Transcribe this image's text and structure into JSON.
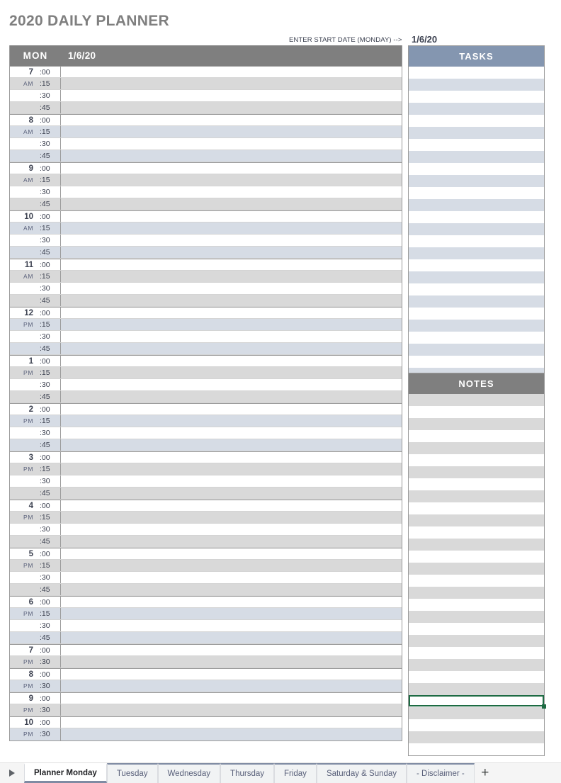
{
  "document": {
    "title": "2020 DAILY PLANNER"
  },
  "start_date": {
    "note": "ENTER START DATE (MONDAY) -->",
    "value": "1/6/20"
  },
  "schedule": {
    "day_of_week": "MON",
    "date": "1/6/20",
    "hours": [
      {
        "hour": "7",
        "ampm": "AM",
        "shade": "gray",
        "minutes": [
          ":00",
          ":15",
          ":30",
          ":45"
        ]
      },
      {
        "hour": "8",
        "ampm": "AM",
        "shade": "blue",
        "minutes": [
          ":00",
          ":15",
          ":30",
          ":45"
        ]
      },
      {
        "hour": "9",
        "ampm": "AM",
        "shade": "gray",
        "minutes": [
          ":00",
          ":15",
          ":30",
          ":45"
        ]
      },
      {
        "hour": "10",
        "ampm": "AM",
        "shade": "blue",
        "minutes": [
          ":00",
          ":15",
          ":30",
          ":45"
        ]
      },
      {
        "hour": "11",
        "ampm": "AM",
        "shade": "gray",
        "minutes": [
          ":00",
          ":15",
          ":30",
          ":45"
        ]
      },
      {
        "hour": "12",
        "ampm": "PM",
        "shade": "blue",
        "minutes": [
          ":00",
          ":15",
          ":30",
          ":45"
        ]
      },
      {
        "hour": "1",
        "ampm": "PM",
        "shade": "gray",
        "minutes": [
          ":00",
          ":15",
          ":30",
          ":45"
        ]
      },
      {
        "hour": "2",
        "ampm": "PM",
        "shade": "blue",
        "minutes": [
          ":00",
          ":15",
          ":30",
          ":45"
        ]
      },
      {
        "hour": "3",
        "ampm": "PM",
        "shade": "gray",
        "minutes": [
          ":00",
          ":15",
          ":30",
          ":45"
        ]
      },
      {
        "hour": "4",
        "ampm": "PM",
        "shade": "gray",
        "minutes": [
          ":00",
          ":15",
          ":30",
          ":45"
        ]
      },
      {
        "hour": "5",
        "ampm": "PM",
        "shade": "gray",
        "minutes": [
          ":00",
          ":15",
          ":30",
          ":45"
        ]
      },
      {
        "hour": "6",
        "ampm": "PM",
        "shade": "blue",
        "minutes": [
          ":00",
          ":15",
          ":30",
          ":45"
        ]
      },
      {
        "hour": "7",
        "ampm": "PM",
        "shade": "gray",
        "minutes": [
          ":00",
          ":30"
        ]
      },
      {
        "hour": "8",
        "ampm": "PM",
        "shade": "blue",
        "minutes": [
          ":00",
          ":30"
        ]
      },
      {
        "hour": "9",
        "ampm": "PM",
        "shade": "gray",
        "minutes": [
          ":00",
          ":30"
        ]
      },
      {
        "hour": "10",
        "ampm": "PM",
        "shade": "blue",
        "minutes": [
          ":00",
          ":30"
        ]
      }
    ],
    "entries": []
  },
  "tasks_panel": {
    "header": "TASKS",
    "row_count": 26,
    "first_row_shade": "white",
    "shade_color": "#d6dce5",
    "items": []
  },
  "notes_panel": {
    "header": "NOTES",
    "row_count": 30,
    "first_row_shade": "gray",
    "shade_color": "#d9d9d9",
    "items": [],
    "selected_row_index": 25
  },
  "selection": {
    "border_color": "#1d6b43",
    "has_fill_handle": true
  },
  "sheet_tabs": {
    "nav_icon": "play-triangle-icon",
    "add_icon": "+",
    "tabs": [
      {
        "label": "Planner Monday",
        "active": true
      },
      {
        "label": "Tuesday",
        "active": false
      },
      {
        "label": "Wednesday",
        "active": false
      },
      {
        "label": "Thursday",
        "active": false
      },
      {
        "label": "Friday",
        "active": false
      },
      {
        "label": "Saturday & Sunday",
        "active": false
      },
      {
        "label": "- Disclaimer -",
        "active": false
      }
    ]
  },
  "theme": {
    "title_color": "#7f7f7f",
    "header_gray": "#7f7f7f",
    "header_blue": "#8496b0",
    "shade_gray": "#d9d9d9",
    "shade_blue": "#d6dce5",
    "text_dark": "#3c4150",
    "grid_line": "#9a9a9a"
  }
}
